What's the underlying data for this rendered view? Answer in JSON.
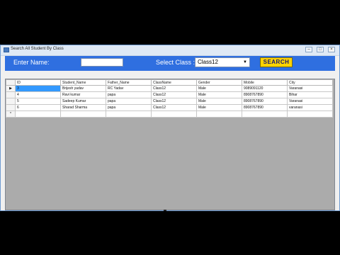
{
  "window": {
    "title": "Search All Student By Class"
  },
  "header": {
    "enter_name_label": "Enter Name:",
    "name_value": "",
    "select_class_label": "Select Class :",
    "selected_class": "Class12",
    "search_button": "SEARCH"
  },
  "grid": {
    "columns": [
      "ID",
      "Student_Name",
      "Father_Name",
      "ClassName",
      "Gender",
      "Mobile",
      "City"
    ],
    "rows": [
      [
        "3",
        "Brijesh yadav",
        "RC Yadav",
        "Class12",
        "Male",
        "9089091120",
        "Varanasi"
      ],
      [
        "4",
        "Ravi kumar",
        "papa",
        "Class12",
        "Male",
        "8908767890",
        "Bihar"
      ],
      [
        "5",
        "Sadeep Kumar",
        "papa",
        "Class12",
        "Male",
        "8908767890",
        "Varanasi"
      ],
      [
        "6",
        "Sharad Sharma",
        "papa",
        "Class12",
        "Male",
        "8908767890",
        "varanasi"
      ]
    ]
  }
}
